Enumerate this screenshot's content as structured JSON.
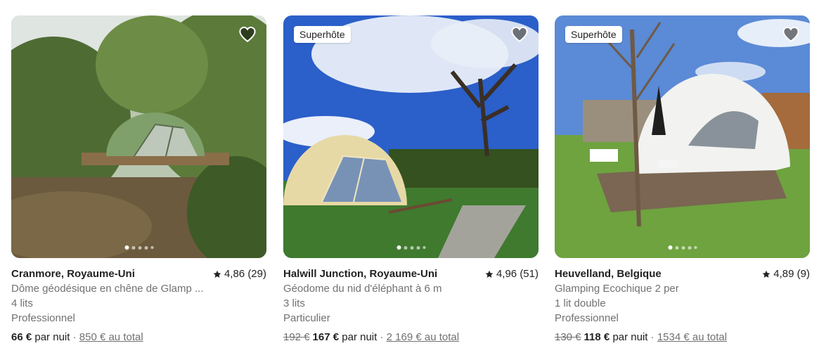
{
  "listings": [
    {
      "badge": "",
      "location": "Cranmore, Royaume-Uni",
      "rating": "4,86 (29)",
      "description": "Dôme géodésique en chêne de Glamp ...",
      "beds": "4 lits",
      "host_type": "Professionnel",
      "old_price": "",
      "price": "66 €",
      "per_night": "par nuit",
      "separator": "·",
      "total": "850 € au total",
      "photo_index": 1,
      "photo_count": 5
    },
    {
      "badge": "Superhôte",
      "location": "Halwill Junction, Royaume-Uni",
      "rating": "4,96 (51)",
      "description": "Géodome du nid d'éléphant à 6 m",
      "beds": "3 lits",
      "host_type": "Particulier",
      "old_price": "192 €",
      "price": "167 €",
      "per_night": "par nuit",
      "separator": "·",
      "total": "2 169 € au total",
      "photo_index": 1,
      "photo_count": 5
    },
    {
      "badge": "Superhôte",
      "location": "Heuvelland, Belgique",
      "rating": "4,89 (9)",
      "description": "Glamping Ecochique 2 per",
      "beds": "1 lit double",
      "host_type": "Professionnel",
      "old_price": "130 €",
      "price": "118 €",
      "per_night": "par nuit",
      "separator": "·",
      "total": "1534 € au total",
      "photo_index": 1,
      "photo_count": 5
    }
  ],
  "icons": {
    "favorite": "heart-icon",
    "rating": "star-icon"
  },
  "colors": {
    "text": "#222222",
    "muted": "#717171",
    "badge_bg": "#ffffff"
  }
}
